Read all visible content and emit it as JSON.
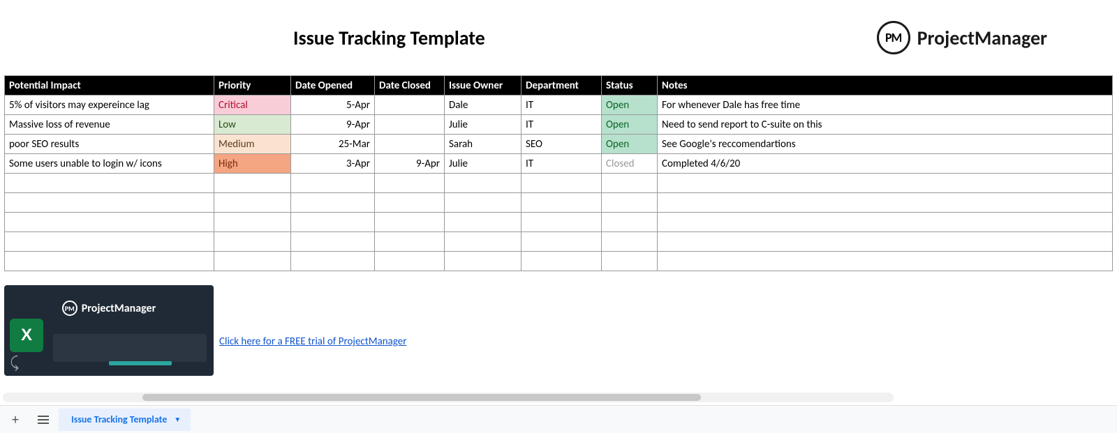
{
  "title": "Issue Tracking Template",
  "brand": "ProjectManager",
  "brand_abbr": "PM",
  "columns": {
    "impact": "Potential Impact",
    "priority": "Priority",
    "opened": "Date Opened",
    "closed": "Date Closed",
    "owner": "Issue Owner",
    "dept": "Department",
    "status": "Status",
    "notes": "Notes"
  },
  "rows": [
    {
      "impact": "5% of visitors may expereince lag",
      "priority": "Critical",
      "opened": "5-Apr",
      "closed": "",
      "owner": "Dale",
      "dept": "IT",
      "status": "Open",
      "notes": "For whenever Dale has free time"
    },
    {
      "impact": "Massive loss of revenue",
      "priority": "Low",
      "opened": "9-Apr",
      "closed": "",
      "owner": "Julie",
      "dept": "IT",
      "status": "Open",
      "notes": "Need to send report to C-suite on this"
    },
    {
      "impact": "poor SEO results",
      "priority": "Medium",
      "opened": "25-Mar",
      "closed": "",
      "owner": "Sarah",
      "dept": "SEO",
      "status": "Open",
      "notes": "See Google's reccomendartions"
    },
    {
      "impact": "Some users unable to login w/ icons",
      "priority": "High",
      "opened": "3-Apr",
      "closed": "9-Apr",
      "owner": "Julie",
      "dept": "IT",
      "status": "Closed",
      "notes": "Completed 4/6/20"
    }
  ],
  "empty_rows": 5,
  "promo_link_text": "Click here for a FREE trial of ProjectManager",
  "excel_badge": "X",
  "tab_name": "Issue Tracking Template"
}
